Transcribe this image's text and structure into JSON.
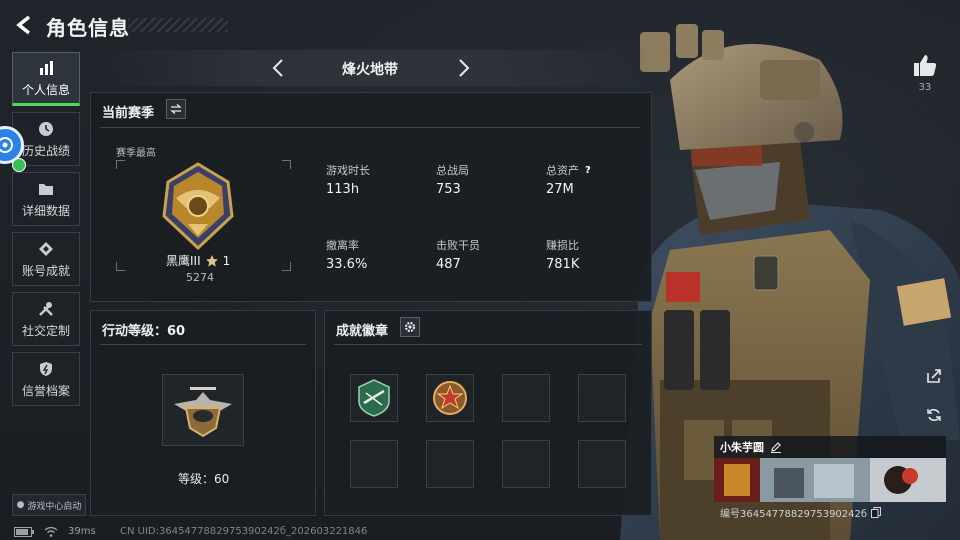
{
  "header": {
    "title": "角色信息"
  },
  "sidebar": {
    "items": [
      {
        "label": "个人信息",
        "icon": "bar-chart-icon",
        "active": true
      },
      {
        "label": "历史战绩",
        "icon": "clock-icon"
      },
      {
        "label": "详细数据",
        "icon": "folder-icon"
      },
      {
        "label": "账号成就",
        "icon": "medal-icon"
      },
      {
        "label": "社交定制",
        "icon": "tools-icon"
      },
      {
        "label": "信誉档案",
        "icon": "shield-icon"
      }
    ],
    "game_center": "游戏中心启动"
  },
  "status_bar": {
    "ping": "39ms",
    "uid": "CN UID:3645477882975390242б_202603221846"
  },
  "map_selector": {
    "name": "烽火地带"
  },
  "season_panel": {
    "title": "当前赛季",
    "subtitle": "赛季最高",
    "rank_name": "黑鹰III",
    "rank_stars": "1",
    "rank_score": "5274",
    "stats": [
      {
        "label": "游戏时长",
        "value": "113h"
      },
      {
        "label": "总战局",
        "value": "753"
      },
      {
        "label": "总资产",
        "value": "27M"
      },
      {
        "label": "撤离率",
        "value": "33.6%"
      },
      {
        "label": "击败干员",
        "value": "487"
      },
      {
        "label": "赚损比",
        "value": "781K"
      }
    ],
    "help_symbol": "?"
  },
  "action_panel": {
    "title": "行动等级：60",
    "level_text": "等级：60"
  },
  "achievement_panel": {
    "title": "成就徽章"
  },
  "player": {
    "likes": "33",
    "name": "小朱芋圆",
    "id": "编号3645477882975390242б"
  },
  "colors": {
    "accent_green": "#4ade5a",
    "panel_bg": "#1a1e23",
    "border": "#353b42"
  }
}
